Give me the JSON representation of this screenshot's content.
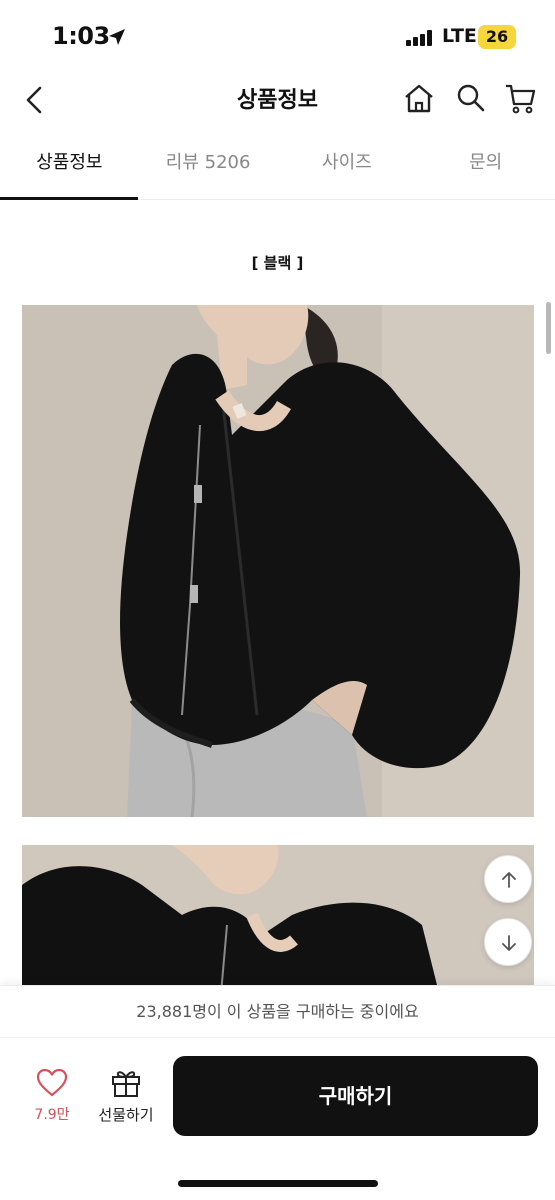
{
  "status_bar": {
    "time": "1:03",
    "network": "LTE",
    "battery": "26",
    "battery_color": "#f5d63b"
  },
  "header": {
    "title": "상품정보"
  },
  "tabs": [
    {
      "label": "상품정보",
      "active": true
    },
    {
      "label": "리뷰 5206",
      "active": false
    },
    {
      "label": "사이즈",
      "active": false
    },
    {
      "label": "문의",
      "active": false
    }
  ],
  "content": {
    "color_caption": "[ 블랙 ]"
  },
  "notice": {
    "text": "23,881명이 이 상품을 구매하는 중이에요"
  },
  "bottom": {
    "like_count": "7.9만",
    "gift_label": "선물하기",
    "buy_label": "구매하기",
    "accent_color": "#d8505c"
  }
}
